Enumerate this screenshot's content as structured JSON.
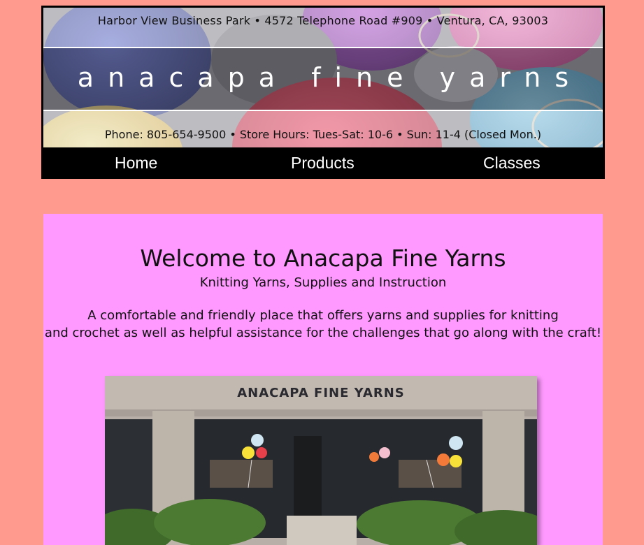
{
  "header": {
    "address": "Harbor View Business Park • 4572 Telephone Road #909 • Ventura, CA, 93003",
    "store_name": "anacapa fine yarns",
    "contact": "Phone: 805-654-9500 • Store Hours: Tues-Sat: 10-6 • Sun: 11-4 (Closed Mon.)"
  },
  "nav": {
    "items": [
      {
        "label": "Home"
      },
      {
        "label": "Products"
      },
      {
        "label": "Classes"
      }
    ]
  },
  "main": {
    "title": "Welcome to Anacapa Fine Yarns",
    "subtitle": "Knitting Yarns, Supplies and Instruction",
    "description_line1": "A comfortable and friendly place that offers yarns and supplies for knitting",
    "description_line2": "and crochet as well as helpful assistance for the challenges that go along with the craft!",
    "storefront_sign": "ANACAPA FINE YARNS"
  },
  "colors": {
    "page_background": "#ff9a8f",
    "content_background": "#ff99ff",
    "nav_background": "#000000",
    "nav_text": "#ffffff"
  }
}
